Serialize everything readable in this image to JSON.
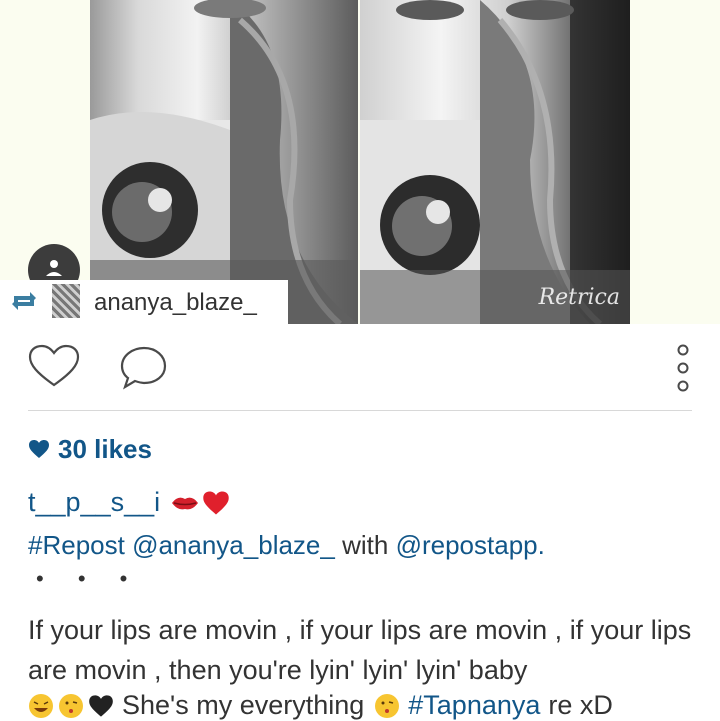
{
  "post": {
    "watermark": "Retrica",
    "repost_username": "ananya_blaze_",
    "likes_label": "30 likes",
    "caption_username": "t__p__s__i",
    "repost_tag": "#Repost",
    "repost_mention": "@ananya_blaze_",
    "with_word": "with",
    "app_mention": "@repostapp.",
    "dots": "• • •",
    "caption_line": "If your lips are movin , if your lips are movin , if your lips are movin , then you're lyin' lyin' lyin' baby",
    "last_text": "She's my everything",
    "last_tag": "#Tapnanya",
    "last_suffix": "re xD"
  },
  "icons": {
    "avatar": "person-icon",
    "repost": "repost-arrows-icon",
    "like": "heart-outline-icon",
    "comment": "speech-bubble-icon",
    "more": "vertical-dots-icon",
    "likes_heart": "heart-filled-icon"
  },
  "colors": {
    "link_blue": "#125688",
    "text_gray": "#333333",
    "divider": "#d8d8d8"
  }
}
